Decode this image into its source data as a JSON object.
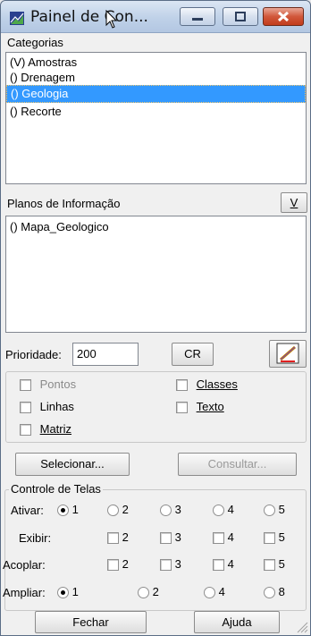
{
  "window": {
    "title": "Painel de Con...",
    "icon": "map-app-icon"
  },
  "categories": {
    "label": "Categorias",
    "items": [
      "(V) Amostras",
      "() Drenagem",
      "() Geologia",
      "() Recorte"
    ],
    "selected_index": 2
  },
  "planes": {
    "label": "Planos de Informação",
    "v_button": "V",
    "items": [
      "() Mapa_Geologico"
    ]
  },
  "priority": {
    "label": "Prioridade:",
    "value": "200",
    "cr_button": "CR",
    "pen_icon": "pen-edit-icon"
  },
  "representations": {
    "pontos": "Pontos",
    "classes": "Classes",
    "linhas": "Linhas",
    "texto": "Texto",
    "matriz": "Matriz"
  },
  "actions": {
    "selecionar": "Selecionar...",
    "consultar": "Consultar..."
  },
  "screens": {
    "title": "Controle de Telas",
    "ativar_label": "Ativar:",
    "exibir_label": "Exibir:",
    "acoplar_label": "Acoplar:",
    "ampliar_label": "Ampliar:",
    "ativar_options": [
      "1",
      "2",
      "3",
      "4",
      "5"
    ],
    "ativar_selected": "1",
    "exibir_options": [
      "2",
      "3",
      "4",
      "5"
    ],
    "acoplar_options": [
      "2",
      "3",
      "4",
      "5"
    ],
    "ampliar_options": [
      "1",
      "2",
      "4",
      "8"
    ],
    "ampliar_selected": "1"
  },
  "footer": {
    "fechar": "Fechar",
    "ajuda": "Ajuda"
  }
}
